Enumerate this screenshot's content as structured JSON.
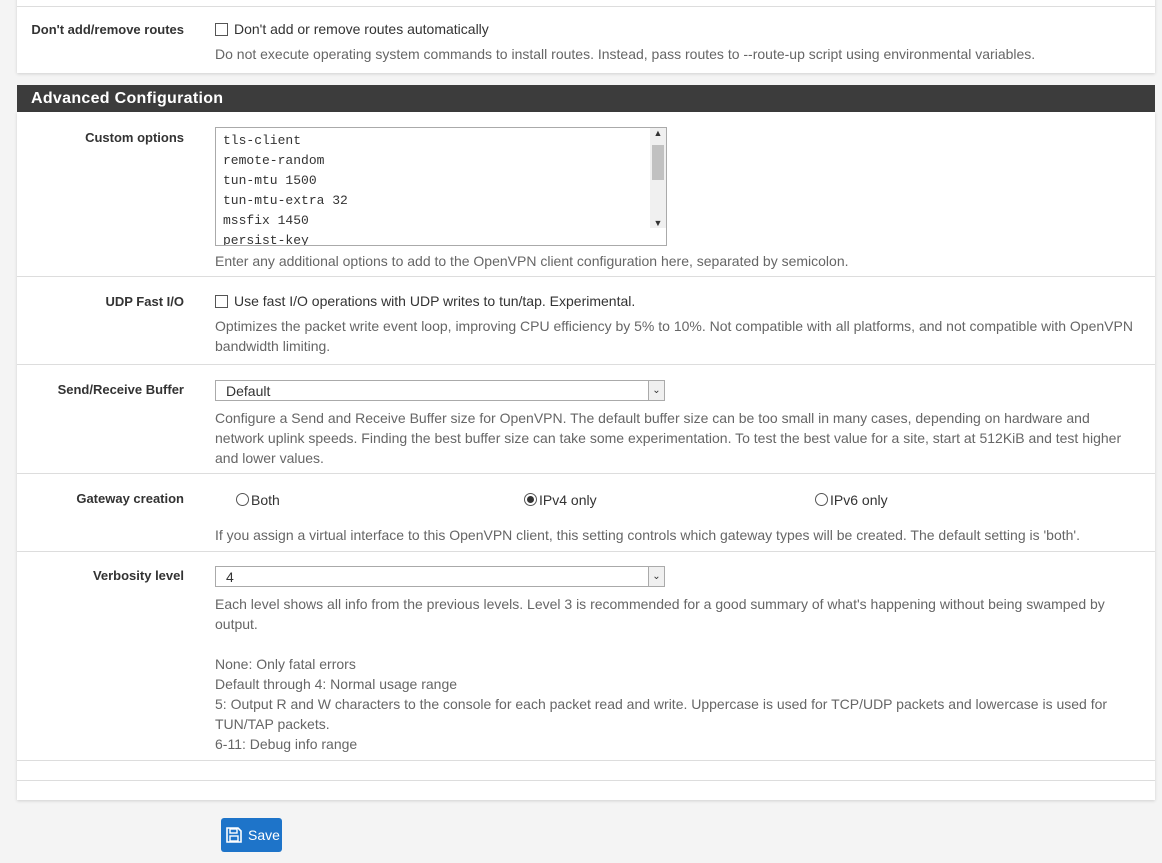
{
  "routes": {
    "label": "Don't add/remove routes",
    "checkbox_label": "Don't add or remove routes automatically",
    "checked": false,
    "help": "Do not execute operating system commands to install routes. Instead, pass routes to --route-up script using environmental variables."
  },
  "section": {
    "title": "Advanced Configuration"
  },
  "custom_options": {
    "label": "Custom options",
    "lines": [
      "tls-client",
      "remote-random",
      "tun-mtu 1500",
      "tun-mtu-extra 32",
      "mssfix 1450",
      "persist-key"
    ],
    "help": "Enter any additional options to add to the OpenVPN client configuration here, separated by semicolon."
  },
  "udp_fast_io": {
    "label": "UDP Fast I/O",
    "checkbox_label": "Use fast I/O operations with UDP writes to tun/tap. Experimental.",
    "checked": false,
    "help": "Optimizes the packet write event loop, improving CPU efficiency by 5% to 10%. Not compatible with all platforms, and not compatible with OpenVPN bandwidth limiting."
  },
  "buffer": {
    "label": "Send/Receive Buffer",
    "value": "Default",
    "help": "Configure a Send and Receive Buffer size for OpenVPN. The default buffer size can be too small in many cases, depending on hardware and network uplink speeds. Finding the best buffer size can take some experimentation. To test the best value for a site, start at 512KiB and test higher and lower values."
  },
  "gateway": {
    "label": "Gateway creation",
    "options": [
      "Both",
      "IPv4 only",
      "IPv6 only"
    ],
    "selected": "IPv4 only",
    "help": "If you assign a virtual interface to this OpenVPN client, this setting controls which gateway types will be created. The default setting is 'both'."
  },
  "verbosity": {
    "label": "Verbosity level",
    "value": "4",
    "help": "Each level shows all info from the previous levels. Level 3 is recommended for a good summary of what's happening without being swamped by output.",
    "levels": [
      "None: Only fatal errors",
      "Default through 4: Normal usage range",
      "5: Output R and W characters to the console for each packet read and write. Uppercase is used for TCP/UDP packets and lowercase is used for TUN/TAP packets.",
      "6-11: Debug info range"
    ]
  },
  "save": {
    "label": "Save",
    "icon": "floppy-disk-icon",
    "color": "#1e74c9"
  }
}
